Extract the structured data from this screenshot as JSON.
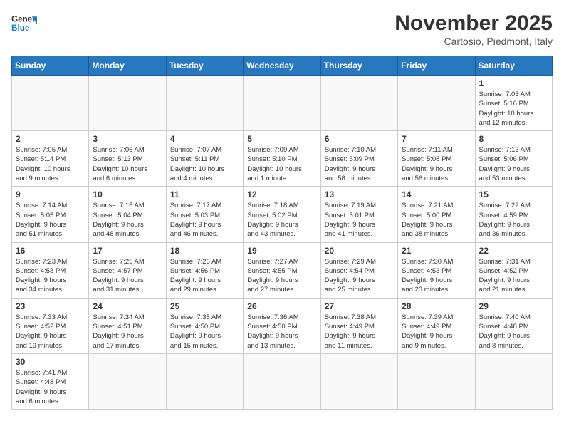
{
  "header": {
    "logo_general": "General",
    "logo_blue": "Blue",
    "month_year": "November 2025",
    "location": "Cartosio, Piedmont, Italy"
  },
  "days_of_week": [
    "Sunday",
    "Monday",
    "Tuesday",
    "Wednesday",
    "Thursday",
    "Friday",
    "Saturday"
  ],
  "weeks": [
    [
      {
        "day": "",
        "info": ""
      },
      {
        "day": "",
        "info": ""
      },
      {
        "day": "",
        "info": ""
      },
      {
        "day": "",
        "info": ""
      },
      {
        "day": "",
        "info": ""
      },
      {
        "day": "",
        "info": ""
      },
      {
        "day": "1",
        "info": "Sunrise: 7:03 AM\nSunset: 5:16 PM\nDaylight: 10 hours\nand 12 minutes."
      }
    ],
    [
      {
        "day": "2",
        "info": "Sunrise: 7:05 AM\nSunset: 5:14 PM\nDaylight: 10 hours\nand 9 minutes."
      },
      {
        "day": "3",
        "info": "Sunrise: 7:06 AM\nSunset: 5:13 PM\nDaylight: 10 hours\nand 6 minutes."
      },
      {
        "day": "4",
        "info": "Sunrise: 7:07 AM\nSunset: 5:11 PM\nDaylight: 10 hours\nand 4 minutes."
      },
      {
        "day": "5",
        "info": "Sunrise: 7:09 AM\nSunset: 5:10 PM\nDaylight: 10 hours\nand 1 minute."
      },
      {
        "day": "6",
        "info": "Sunrise: 7:10 AM\nSunset: 5:09 PM\nDaylight: 9 hours\nand 58 minutes."
      },
      {
        "day": "7",
        "info": "Sunrise: 7:11 AM\nSunset: 5:08 PM\nDaylight: 9 hours\nand 56 minutes."
      },
      {
        "day": "8",
        "info": "Sunrise: 7:13 AM\nSunset: 5:06 PM\nDaylight: 9 hours\nand 53 minutes."
      }
    ],
    [
      {
        "day": "9",
        "info": "Sunrise: 7:14 AM\nSunset: 5:05 PM\nDaylight: 9 hours\nand 51 minutes."
      },
      {
        "day": "10",
        "info": "Sunrise: 7:15 AM\nSunset: 5:04 PM\nDaylight: 9 hours\nand 48 minutes."
      },
      {
        "day": "11",
        "info": "Sunrise: 7:17 AM\nSunset: 5:03 PM\nDaylight: 9 hours\nand 46 minutes."
      },
      {
        "day": "12",
        "info": "Sunrise: 7:18 AM\nSunset: 5:02 PM\nDaylight: 9 hours\nand 43 minutes."
      },
      {
        "day": "13",
        "info": "Sunrise: 7:19 AM\nSunset: 5:01 PM\nDaylight: 9 hours\nand 41 minutes."
      },
      {
        "day": "14",
        "info": "Sunrise: 7:21 AM\nSunset: 5:00 PM\nDaylight: 9 hours\nand 38 minutes."
      },
      {
        "day": "15",
        "info": "Sunrise: 7:22 AM\nSunset: 4:59 PM\nDaylight: 9 hours\nand 36 minutes."
      }
    ],
    [
      {
        "day": "16",
        "info": "Sunrise: 7:23 AM\nSunset: 4:58 PM\nDaylight: 9 hours\nand 34 minutes."
      },
      {
        "day": "17",
        "info": "Sunrise: 7:25 AM\nSunset: 4:57 PM\nDaylight: 9 hours\nand 31 minutes."
      },
      {
        "day": "18",
        "info": "Sunrise: 7:26 AM\nSunset: 4:56 PM\nDaylight: 9 hours\nand 29 minutes."
      },
      {
        "day": "19",
        "info": "Sunrise: 7:27 AM\nSunset: 4:55 PM\nDaylight: 9 hours\nand 27 minutes."
      },
      {
        "day": "20",
        "info": "Sunrise: 7:29 AM\nSunset: 4:54 PM\nDaylight: 9 hours\nand 25 minutes."
      },
      {
        "day": "21",
        "info": "Sunrise: 7:30 AM\nSunset: 4:53 PM\nDaylight: 9 hours\nand 23 minutes."
      },
      {
        "day": "22",
        "info": "Sunrise: 7:31 AM\nSunset: 4:52 PM\nDaylight: 9 hours\nand 21 minutes."
      }
    ],
    [
      {
        "day": "23",
        "info": "Sunrise: 7:33 AM\nSunset: 4:52 PM\nDaylight: 9 hours\nand 19 minutes."
      },
      {
        "day": "24",
        "info": "Sunrise: 7:34 AM\nSunset: 4:51 PM\nDaylight: 9 hours\nand 17 minutes."
      },
      {
        "day": "25",
        "info": "Sunrise: 7:35 AM\nSunset: 4:50 PM\nDaylight: 9 hours\nand 15 minutes."
      },
      {
        "day": "26",
        "info": "Sunrise: 7:36 AM\nSunset: 4:50 PM\nDaylight: 9 hours\nand 13 minutes."
      },
      {
        "day": "27",
        "info": "Sunrise: 7:38 AM\nSunset: 4:49 PM\nDaylight: 9 hours\nand 11 minutes."
      },
      {
        "day": "28",
        "info": "Sunrise: 7:39 AM\nSunset: 4:49 PM\nDaylight: 9 hours\nand 9 minutes."
      },
      {
        "day": "29",
        "info": "Sunrise: 7:40 AM\nSunset: 4:48 PM\nDaylight: 9 hours\nand 8 minutes."
      }
    ],
    [
      {
        "day": "30",
        "info": "Sunrise: 7:41 AM\nSunset: 4:48 PM\nDaylight: 9 hours\nand 6 minutes."
      },
      {
        "day": "",
        "info": ""
      },
      {
        "day": "",
        "info": ""
      },
      {
        "day": "",
        "info": ""
      },
      {
        "day": "",
        "info": ""
      },
      {
        "day": "",
        "info": ""
      },
      {
        "day": "",
        "info": ""
      }
    ]
  ]
}
